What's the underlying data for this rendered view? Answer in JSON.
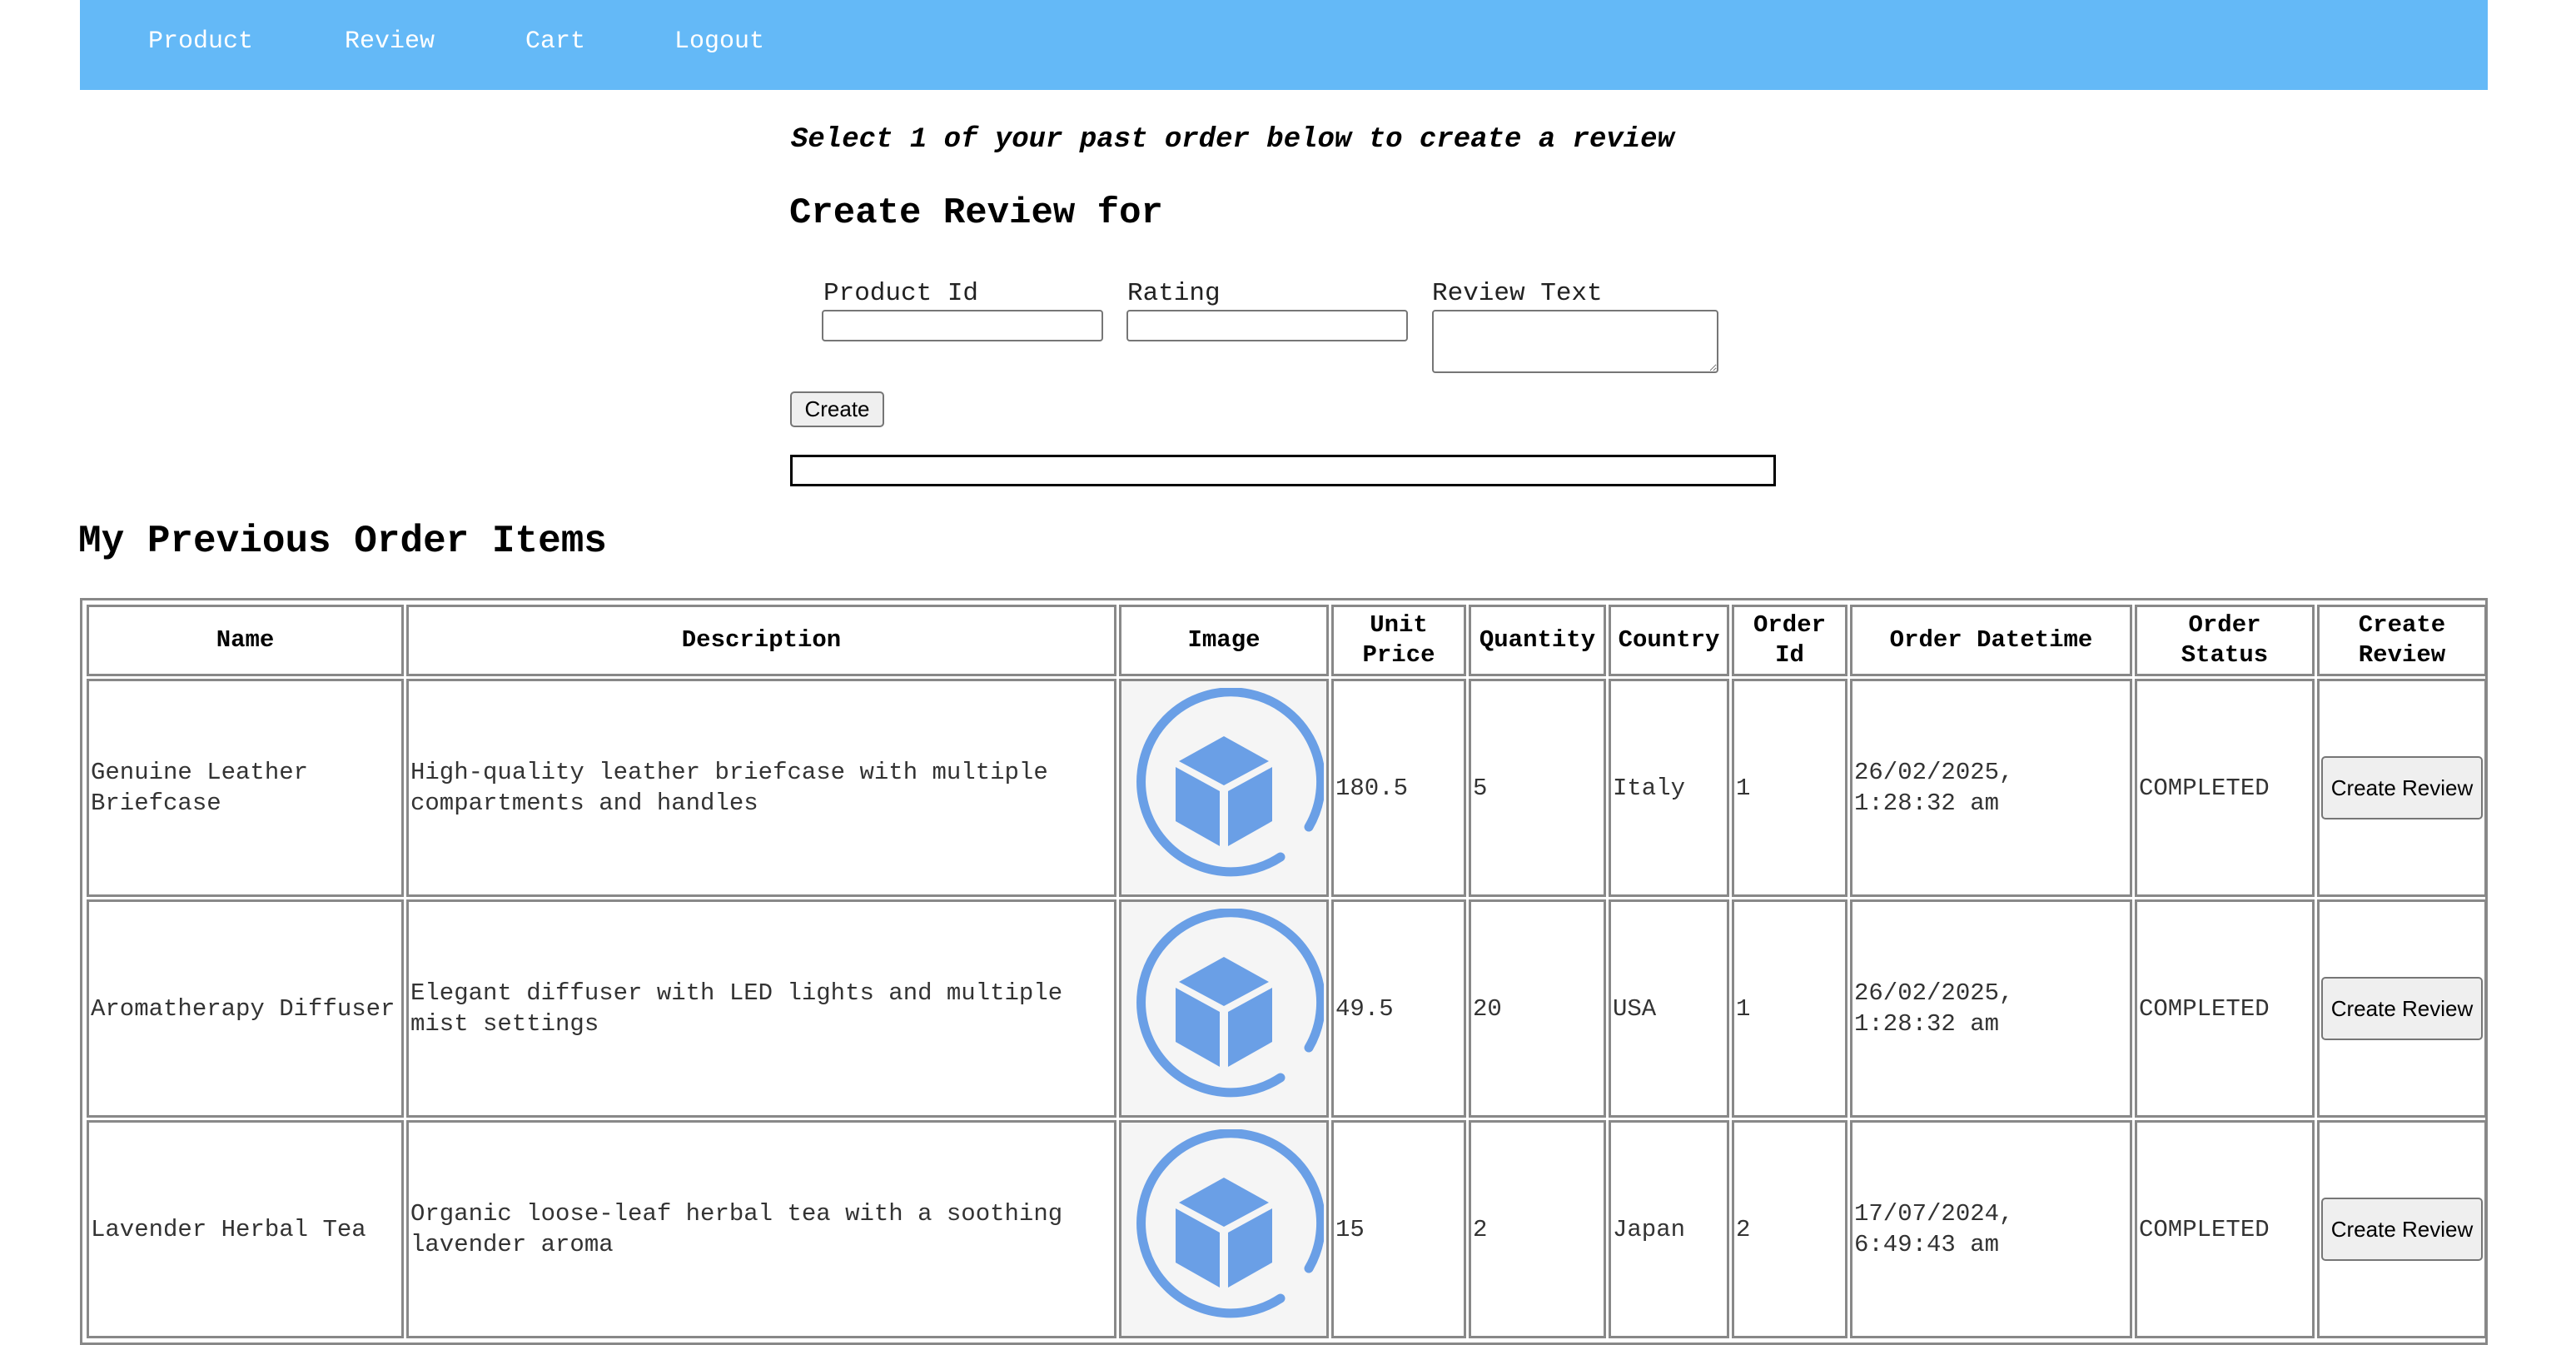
{
  "nav": {
    "items": [
      {
        "label": "Product"
      },
      {
        "label": "Review"
      },
      {
        "label": "Cart"
      },
      {
        "label": "Logout"
      }
    ]
  },
  "review_form": {
    "subtitle": "Select 1 of your past order below to create a review",
    "title": "Create Review for",
    "product_id_label": "Product Id",
    "product_id_value": "",
    "rating_label": "Rating",
    "rating_value": "",
    "review_text_label": "Review Text",
    "review_text_value": "",
    "create_button": "Create",
    "message": ""
  },
  "orders": {
    "title": "My Previous Order Items",
    "columns": [
      "Name",
      "Description",
      "Image",
      "Unit Price",
      "Quantity",
      "Country",
      "Order Id",
      "Order Datetime",
      "Order Status",
      "Create Review"
    ],
    "image_icon": "cube-icon",
    "accent_color": "#6a9fe6",
    "rows": [
      {
        "name": "Genuine Leather Briefcase",
        "description": "High-quality leather briefcase with multiple compartments and handles",
        "unit_price": "180.5",
        "quantity": "5",
        "country": "Italy",
        "order_id": "1",
        "order_datetime": "26/02/2025, 1:28:32 am",
        "order_status": "COMPLETED",
        "action": "Create Review"
      },
      {
        "name": "Aromatherapy Diffuser",
        "description": "Elegant diffuser with LED lights and multiple mist settings",
        "unit_price": "49.5",
        "quantity": "20",
        "country": "USA",
        "order_id": "1",
        "order_datetime": "26/02/2025, 1:28:32 am",
        "order_status": "COMPLETED",
        "action": "Create Review"
      },
      {
        "name": "Lavender Herbal Tea",
        "description": "Organic loose-leaf herbal tea with a soothing lavender aroma",
        "unit_price": "15",
        "quantity": "2",
        "country": "Japan",
        "order_id": "2",
        "order_datetime": "17/07/2024, 6:49:43 am",
        "order_status": "COMPLETED",
        "action": "Create Review"
      }
    ]
  }
}
